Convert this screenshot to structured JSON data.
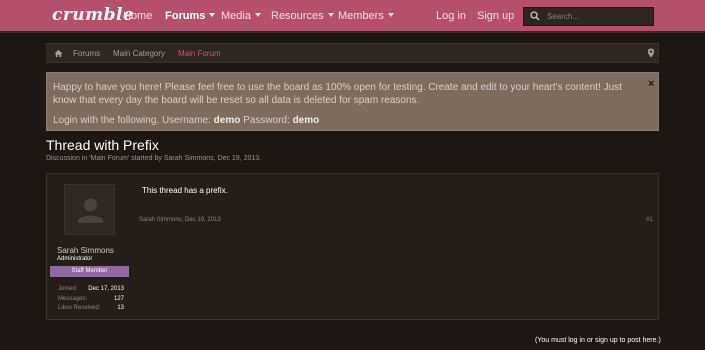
{
  "header": {
    "logo": "crumble",
    "nav": [
      {
        "label": "Home"
      },
      {
        "label": "Forums",
        "active": true,
        "dropdown": true
      },
      {
        "label": "Media",
        "dropdown": true
      },
      {
        "label": "Resources",
        "dropdown": true
      },
      {
        "label": "Members",
        "dropdown": true
      }
    ],
    "login": "Log in",
    "signup": "Sign up",
    "search_placeholder": "Search..."
  },
  "breadcrumb": [
    "Forums",
    "Main Category",
    "Main Forum"
  ],
  "notice": {
    "text1": "Happy to have you here! Please feel free to use the board as 100% open for testing. Create and edit to your heart's content! Just know that every day the board will be reset so all data is deleted for spam reasons.",
    "login_prefix": "Login with the following. Username:",
    "username": "demo",
    "password_label": "Password:",
    "password": "demo",
    "close": "×"
  },
  "thread": {
    "title": "Thread with Prefix",
    "subtitle": "Discussion in 'Main Forum' started by Sarah Simmons, Dec 19, 2013."
  },
  "post": {
    "author": "Sarah Simmons",
    "role": "Administrator",
    "badge": "Staff Member",
    "stats": [
      {
        "label": "Joined:",
        "value": "Dec 17, 2013"
      },
      {
        "label": "Messages:",
        "value": "127"
      },
      {
        "label": "Likes Received:",
        "value": "13"
      }
    ],
    "body": "This thread has a prefix.",
    "meta": "Sarah Simmons, Dec 19, 2013",
    "number": "#1"
  },
  "footer_note": "(You must log in or sign up to post here.)",
  "colors": {
    "accent": "#b5506c",
    "badge": "#8f6aa0",
    "notice": "#7d6c60"
  }
}
